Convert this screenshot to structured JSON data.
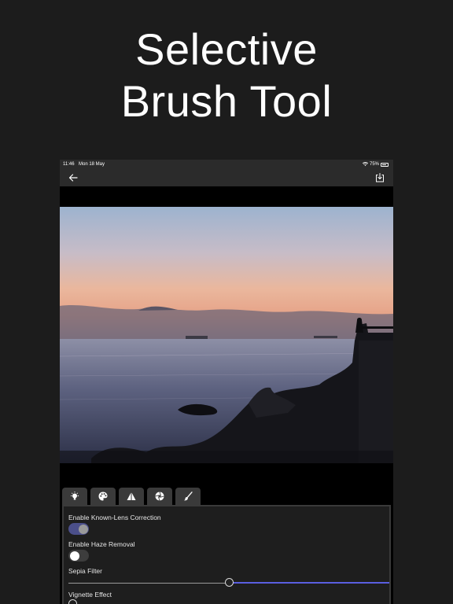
{
  "headline": {
    "line1": "Selective",
    "line2": "Brush Tool"
  },
  "status_bar": {
    "time": "11:46",
    "date": "Mon 18 May",
    "battery": "75%"
  },
  "navigation": {
    "back_icon": "arrow-left-icon",
    "export_icon": "export-download-icon"
  },
  "tabs": [
    {
      "icon": "lightbulb-icon"
    },
    {
      "icon": "palette-icon"
    },
    {
      "icon": "triangle-icon"
    },
    {
      "icon": "lens-icon"
    },
    {
      "icon": "brush-icon"
    }
  ],
  "settings": {
    "lens_correction": {
      "label": "Enable Known-Lens Correction",
      "enabled": true
    },
    "haze_removal": {
      "label": "Enable Haze Removal",
      "enabled": false
    },
    "sepia_filter": {
      "label": "Sepia Filter",
      "value": 0.5
    },
    "vignette_effect": {
      "label": "Vignette Effect"
    }
  },
  "colors": {
    "background": "#1c1c1c",
    "toolbar": "#2b2b2b",
    "accent": "#5a5fe0",
    "toggle_on": "#4b4f8a"
  }
}
